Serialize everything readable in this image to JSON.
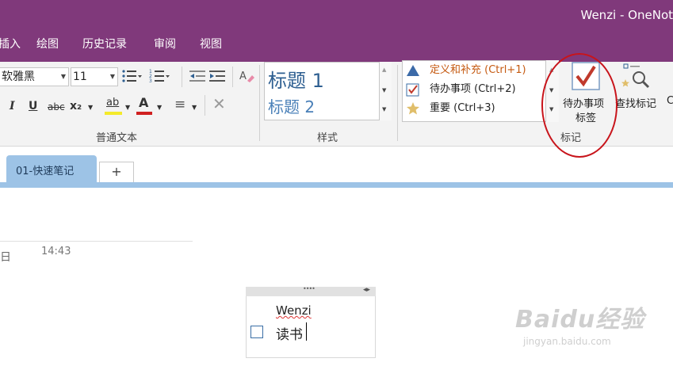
{
  "window": {
    "title": "Wenzi - OneNot"
  },
  "menu": {
    "insert_partial": "插入",
    "draw": "绘图",
    "history": "历史记录",
    "review": "审阅",
    "view": "视图"
  },
  "ribbon": {
    "font_name": "软雅黑",
    "font_size": "11",
    "buttons": {
      "italic": "I",
      "underline": "U",
      "strike": "abc",
      "subscript": "x₂",
      "highlight": "ab",
      "font_color": "A",
      "align": "≡",
      "clear": "✕"
    },
    "groups": {
      "basic_text": "普通文本",
      "styles": "样式",
      "tags": "标记"
    },
    "styles": {
      "heading1": "标题 1",
      "heading2": "标题 2"
    },
    "tags": [
      {
        "label": "定义和补充 (Ctrl+1)",
        "icon": "triangle-icon",
        "color": "#c55a11"
      },
      {
        "label": "待办事项 (Ctrl+2)",
        "icon": "checkbox-icon",
        "color": "#222222"
      },
      {
        "label": "重要 (Ctrl+3)",
        "icon": "star-icon",
        "color": "#222222"
      }
    ],
    "todo_tag": {
      "line1": "待办事项",
      "line2": "标签"
    },
    "find_tags": "查找标记",
    "overflow": "C"
  },
  "tabs": {
    "active": "01-快速笔记",
    "add": "+"
  },
  "page": {
    "day_partial": "日",
    "time": "14:43"
  },
  "note": {
    "title": "Wenzi",
    "item": "读书",
    "handle": "••••",
    "handle_arrows": "◂▸"
  },
  "watermark": {
    "logo": "Baidu经验",
    "url": "jingyan.baidu.com"
  },
  "colors": {
    "title_bar": "#80397b",
    "tab_blue": "#9dc3e6",
    "highlight_red": "#c8141b"
  }
}
